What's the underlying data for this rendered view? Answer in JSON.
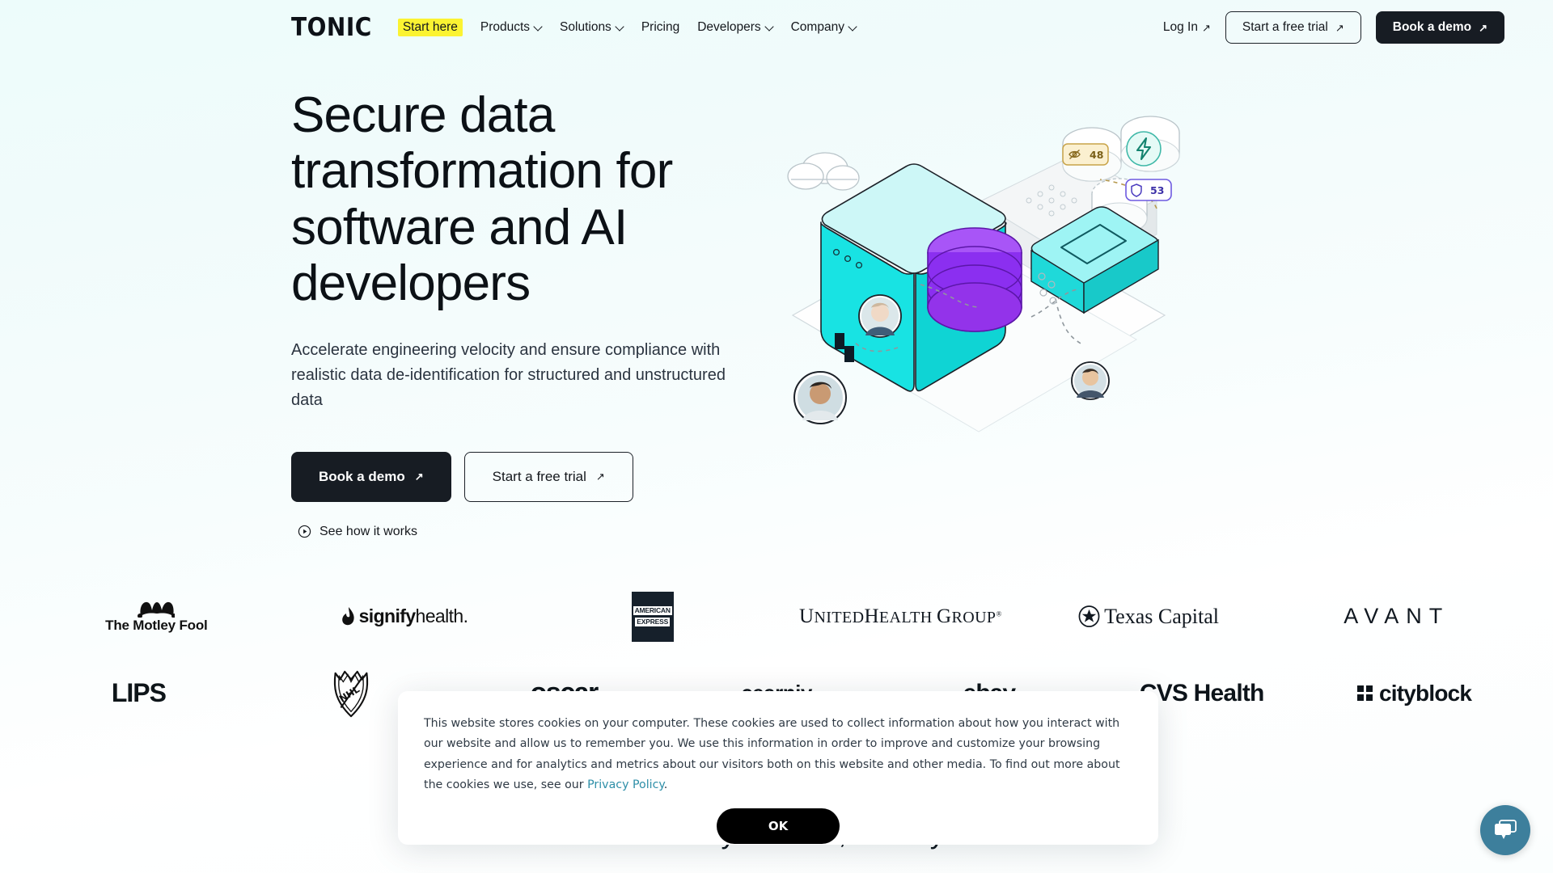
{
  "brand": {
    "logo": "TONIC"
  },
  "nav": {
    "items": [
      {
        "label": "Start here",
        "highlight": true,
        "caret": false
      },
      {
        "label": "Products",
        "highlight": false,
        "caret": true
      },
      {
        "label": "Solutions",
        "highlight": false,
        "caret": true
      },
      {
        "label": "Pricing",
        "highlight": false,
        "caret": false
      },
      {
        "label": "Developers",
        "highlight": false,
        "caret": true
      },
      {
        "label": "Company",
        "highlight": false,
        "caret": true
      }
    ],
    "login": "Log In",
    "login_arrow": "↗",
    "trial_button": "Start a free trial",
    "trial_arrow": "↗",
    "demo_button": "Book a demo",
    "demo_arrow": "↗"
  },
  "hero": {
    "title": "Secure data transformation for software and AI developers",
    "subtitle": "Accelerate engineering velocity and ensure compliance with realistic data de-identification for structured and unstructured data",
    "cta_primary": "Book a demo",
    "cta_primary_arrow": "↗",
    "cta_secondary": "Start a free trial",
    "cta_secondary_arrow": "↗",
    "video_link": "See how it works",
    "illustration": {
      "badge_masked_value": "48",
      "badge_shield_value": "53",
      "colors": {
        "cube_front": "#18e3e3",
        "cube_top": "#cdf7f7",
        "cube_side": "#0fd4d4",
        "database": "#8b2ff0",
        "database_top": "#a855f7",
        "badge_masked_bg": "#fbf0d0",
        "badge_masked_border": "#c8a348",
        "badge_shield_border": "#6d5ae0",
        "bolt_circle": "#e5faf6",
        "bolt_border": "#3fb8a8"
      }
    }
  },
  "logos": {
    "row1": [
      "The Motley Fool",
      "signifyhealth",
      "AMERICAN EXPRESS",
      "UNITEDHEALTH GROUP",
      "Texas Capital",
      "AVANT"
    ],
    "row2": [
      "LIPS",
      "NHL",
      "oscar",
      "cearniy",
      "ebay",
      "CVS Health",
      "cityblock"
    ]
  },
  "bottom_section": {
    "headline": "Generate the data you need, when you need it"
  },
  "cookie_banner": {
    "paragraph_part1": "This website stores cookies on your computer. These cookies are used to collect information about how you interact with our website and allow us to remember you. We use this information in order to improve and customize your browsing experience and for analytics and metrics about our visitors both on this website and other media. To find out more about the cookies we use, see our ",
    "link_text": "Privacy Policy",
    "paragraph_part2": ".",
    "ok_button": "OK"
  },
  "chat_widget": {
    "label": "chat-bubble-icon"
  }
}
